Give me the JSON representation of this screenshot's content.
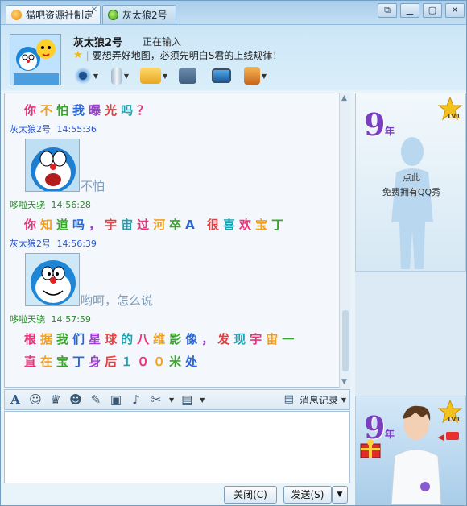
{
  "tabs": [
    {
      "label": "猫吧资源社制定",
      "close": "✕"
    },
    {
      "label": "灰太狼2号"
    }
  ],
  "window_buttons": [
    "⧉",
    "▁",
    "▢",
    "✕"
  ],
  "contact": {
    "name": "灰太狼2号",
    "status": "正在输入",
    "signature": "要想弄好地图，必须先明白S君的上线规律！",
    "sep": "|"
  },
  "messages": {
    "m1_text": "你不怕我曝光吗？",
    "s1_name": "灰太狼2号",
    "s1_time": "14:55:36",
    "sticker1_caption": "不怕",
    "s2_name": "哆啦天骁",
    "s2_time": "14:56:28",
    "m2_text": "你知道吗，宇宙过河卒A 很喜欢宝丁",
    "s3_name": "灰太狼2号",
    "s3_time": "14:56:39",
    "sticker2_caption": "哟呵，怎么说",
    "s4_name": "哆啦天骁",
    "s4_time": "14:57:59",
    "m3_line1": "根据我们星球的八维影像，发现宇宙一",
    "m3_line2": "直在宝丁身后１００米处"
  },
  "input_toolbar": {
    "font_icon": "A",
    "history_label": "消息记录"
  },
  "buttons": {
    "close": "关闭(C)",
    "send": "发送(S)",
    "send_arrow": "▼"
  },
  "side": {
    "nine": "9",
    "year": "年",
    "lv": "LV1",
    "click": "点此",
    "free": "免费拥有QQ秀"
  },
  "colors": {
    "accent": "#2a55c9",
    "green_sender": "#2a8a2a",
    "msg_palette": [
      "#e8337a",
      "#f0a020",
      "#3aa52c",
      "#2a66d8",
      "#9a3fd0",
      "#e24040",
      "#20a0b0"
    ]
  }
}
